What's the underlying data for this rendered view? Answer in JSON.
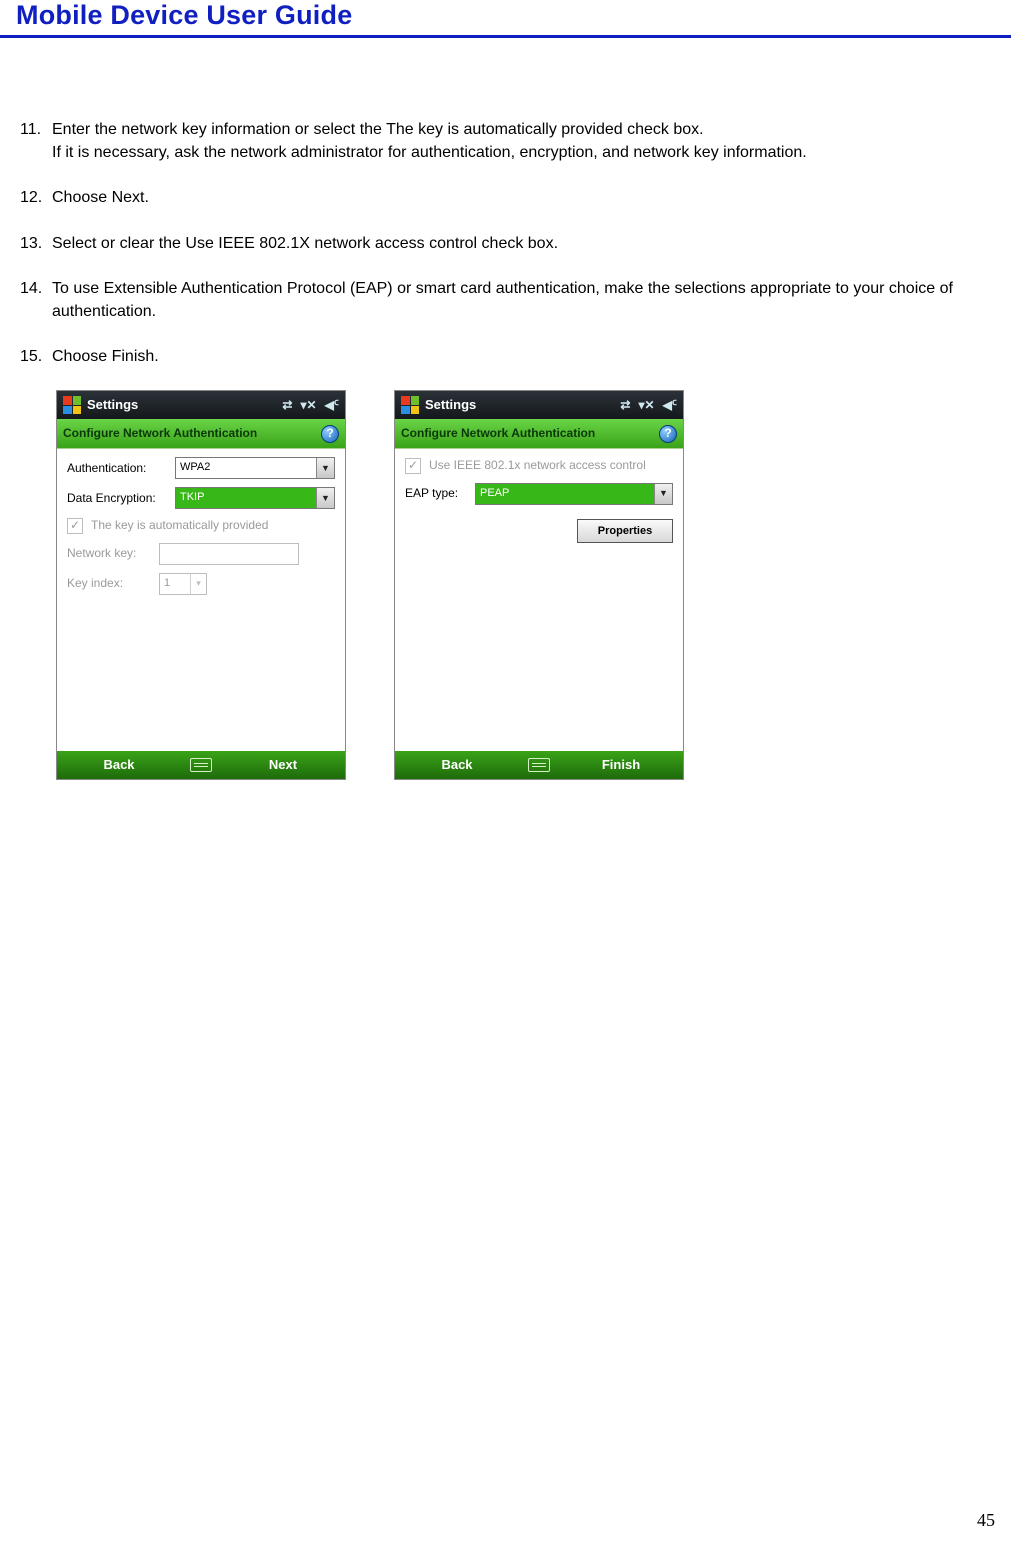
{
  "page": {
    "title": "Mobile Device User Guide",
    "page_number": "45"
  },
  "instructions": [
    {
      "num": "11.",
      "text": "Enter the network key information or select the The key is automatically provided check box.",
      "text2": "If it is necessary, ask the network administrator for authentication, encryption, and network key information."
    },
    {
      "num": "12.",
      "text": "Choose Next."
    },
    {
      "num": "13.",
      "text": "Select or clear the Use IEEE 802.1X network access control check box."
    },
    {
      "num": "14.",
      "text": "To use Extensible Authentication Protocol (EAP) or smart card authentication, make the selections appropriate to your choice of authentication."
    },
    {
      "num": "15.",
      "text": "Choose Finish."
    }
  ],
  "screens": {
    "left": {
      "titlebar": "Settings",
      "subtitle": "Configure Network Authentication",
      "help": "?",
      "fields": {
        "authentication_label": "Authentication:",
        "authentication_value": "WPA2",
        "encryption_label": "Data Encryption:",
        "encryption_value": "TKIP",
        "auto_key_label": "The key is automatically provided",
        "network_key_label": "Network key:",
        "key_index_label": "Key index:",
        "key_index_value": "1"
      },
      "bottombar": {
        "left": "Back",
        "right": "Next"
      }
    },
    "right": {
      "titlebar": "Settings",
      "subtitle": "Configure Network Authentication",
      "help": "?",
      "fields": {
        "ieee_label": "Use IEEE 802.1x network access control",
        "eap_label": "EAP type:",
        "eap_value": "PEAP",
        "properties_btn": "Properties"
      },
      "bottombar": {
        "left": "Back",
        "right": "Finish"
      }
    }
  }
}
